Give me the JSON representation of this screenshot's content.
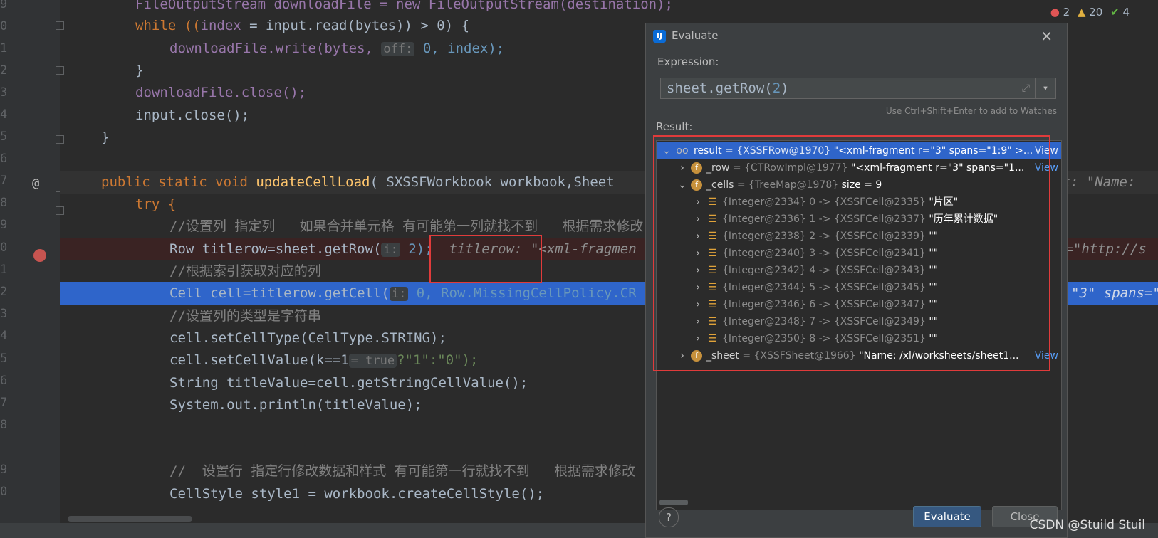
{
  "status": {
    "errors": "2",
    "warnings": "20",
    "checks": "4"
  },
  "gutter_numbers": [
    "9",
    "0",
    "1",
    "2",
    "3",
    "4",
    "5",
    "6",
    "7",
    "8",
    "9",
    "0",
    "1",
    "2",
    "3",
    "4",
    "5",
    "6",
    "7",
    "8",
    "9",
    "0"
  ],
  "code": {
    "l0": "FileOutputStream downloadFile = new FileOutputStream(destination);",
    "l1_a": "while ((",
    "l1_b": "index",
    "l1_c": " = input.read(bytes)) > 0) {",
    "l2_a": "downloadFile.write(bytes, ",
    "l2_hint": "off:",
    "l2_b": " 0, index);",
    "l3": "}",
    "l4": "downloadFile.close();",
    "l5": "input.close();",
    "l6": "}",
    "l8_kw": "public static void ",
    "l8_fn": "updateCellLoad",
    "l8_rest": "( SXSSFWorkbook workbook,Sheet",
    "l8_tail": "et: \"Name:",
    "l9": "try {",
    "l10": "//设置列 指定列   如果合并单元格 有可能第一列就找不到   根据需求修改",
    "l11_a": "Row titlerow=sheet.getRow(",
    "l11_hint": "i:",
    "l11_b": " 2);",
    "l11_val": "  titlerow: \"<xml-fragmen",
    "l11_tail": "r=\"http://s",
    "l12": "//根据索引获取对应的列",
    "l13_a": "Cell cell=titlerow.getCell(",
    "l13_hint": "i:",
    "l13_b": " 0, Row.MissingCellPolicy.CR",
    "l13_tail": "\"3\" spans=\"",
    "l14": "//设置列的类型是字符串",
    "l15": "cell.setCellType(CellType.STRING);",
    "l16_a": "cell.setCellValue(k==1",
    "l16_hint": "= true",
    "l16_b": "?\"1\":\"0\");",
    "l17": "String titleValue=cell.getStringCellValue();",
    "l18": "System.out.println(titleValue);",
    "l21": "//  设置行 指定行修改数据和样式 有可能第一行就找不到   根据需求修改",
    "l22": "CellStyle style1 = workbook.createCellStyle();"
  },
  "dialog": {
    "title": "Evaluate",
    "expression_label": "Expression:",
    "expression_obj": "sheet",
    "expression_method": ".getRow(",
    "expression_arg": "2",
    "expression_close": ")",
    "watch_hint": "Use Ctrl+Shift+Enter to add to Watches",
    "result_label": "Result:",
    "evaluate_button": "Evaluate",
    "close_button": "Close",
    "help": "?"
  },
  "tree": [
    {
      "name": "result",
      "type": " = {XSSFRow@1970} ",
      "value": "\"<xml-fragment r=\"3\" spans=\"1:9\" >...",
      "view": "View"
    },
    {
      "name": "_row",
      "type": " = {CTRowImpl@1977} ",
      "value": "\"<xml-fragment r=\"3\" spans=\"1...",
      "view": "View"
    },
    {
      "name": "_cells",
      "type": " = {TreeMap@1978} ",
      "value": " size = 9",
      "view": ""
    },
    {
      "name": "",
      "type": "{Integer@2334} 0 -> {XSSFCell@2335} ",
      "value": "\"片区\"",
      "view": ""
    },
    {
      "name": "",
      "type": "{Integer@2336} 1 -> {XSSFCell@2337} ",
      "value": "\"历年累计数据\"",
      "view": ""
    },
    {
      "name": "",
      "type": "{Integer@2338} 2 -> {XSSFCell@2339} ",
      "value": "\"\"",
      "view": ""
    },
    {
      "name": "",
      "type": "{Integer@2340} 3 -> {XSSFCell@2341} ",
      "value": "\"\"",
      "view": ""
    },
    {
      "name": "",
      "type": "{Integer@2342} 4 -> {XSSFCell@2343} ",
      "value": "\"\"",
      "view": ""
    },
    {
      "name": "",
      "type": "{Integer@2344} 5 -> {XSSFCell@2345} ",
      "value": "\"\"",
      "view": ""
    },
    {
      "name": "",
      "type": "{Integer@2346} 6 -> {XSSFCell@2347} ",
      "value": "\"\"",
      "view": ""
    },
    {
      "name": "",
      "type": "{Integer@2348} 7 -> {XSSFCell@2349} ",
      "value": "\"\"",
      "view": ""
    },
    {
      "name": "",
      "type": "{Integer@2350} 8 -> {XSSFCell@2351} ",
      "value": "\"\"",
      "view": ""
    },
    {
      "name": "_sheet",
      "type": " = {XSSFSheet@1966} ",
      "value": "\"Name: /xl/worksheets/sheet1...",
      "view": "View"
    }
  ],
  "watermark": "CSDN @Stuild Stuil"
}
